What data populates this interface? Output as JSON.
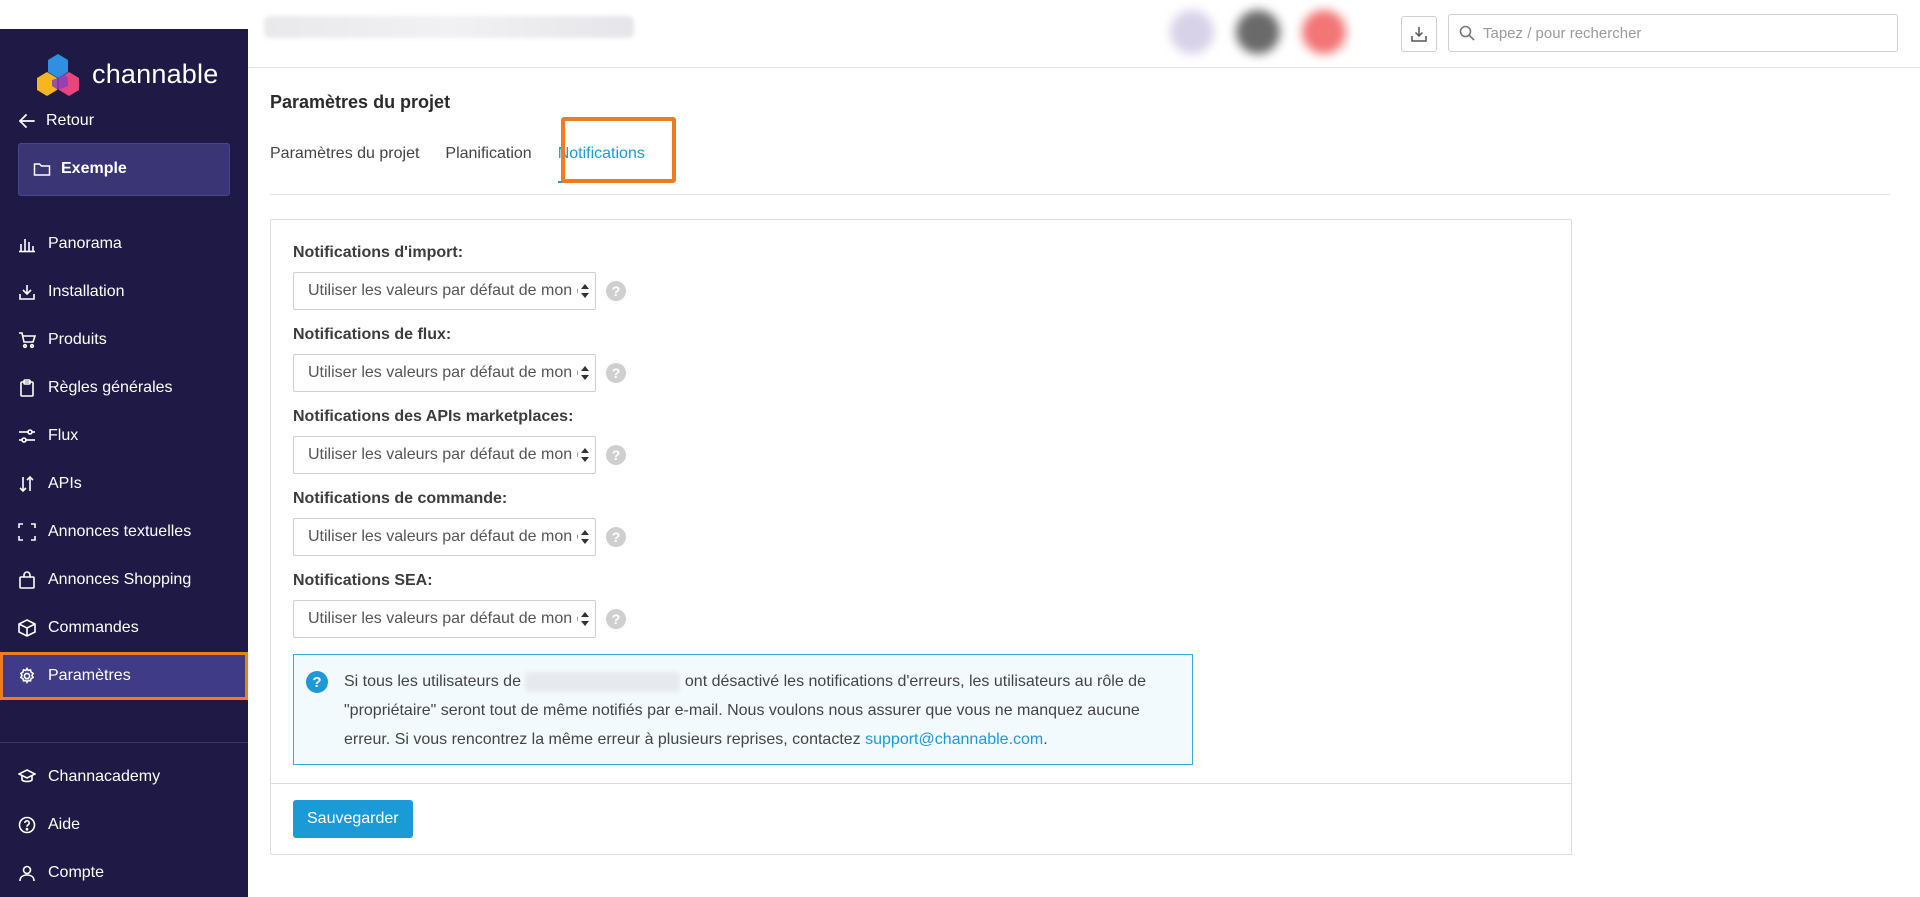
{
  "brand": {
    "name": "channable",
    "accent": "#1f98d6",
    "sidebar_bg": "#1f1a45",
    "highlight": "#f07c1f"
  },
  "sidebar": {
    "back_label": "Retour",
    "project_label": "Exemple",
    "items": [
      {
        "label": "Panorama",
        "icon": "bar-chart-icon"
      },
      {
        "label": "Installation",
        "icon": "download-tray-icon"
      },
      {
        "label": "Produits",
        "icon": "cart-icon"
      },
      {
        "label": "Règles générales",
        "icon": "clipboard-icon"
      },
      {
        "label": "Flux",
        "icon": "sliders-icon"
      },
      {
        "label": "APIs",
        "icon": "up-down-arrows-icon"
      },
      {
        "label": "Annonces textuelles",
        "icon": "frame-corners-icon"
      },
      {
        "label": "Annonces Shopping",
        "icon": "shopping-bag-icon"
      },
      {
        "label": "Commandes",
        "icon": "box-icon"
      },
      {
        "label": "Paramètres",
        "icon": "gear-icon",
        "active": true
      }
    ],
    "bottom_items": [
      {
        "label": "Channacademy",
        "icon": "graduation-cap-icon"
      },
      {
        "label": "Aide",
        "icon": "question-circle-icon"
      },
      {
        "label": "Compte",
        "icon": "user-icon"
      }
    ]
  },
  "topbar": {
    "search_placeholder": "Tapez / pour rechercher"
  },
  "page": {
    "title": "Paramètres du projet",
    "tabs": [
      {
        "label": "Paramètres du projet"
      },
      {
        "label": "Planification"
      },
      {
        "label": "Notifications",
        "active": true
      }
    ]
  },
  "form": {
    "fields": [
      {
        "label": "Notifications d'import:",
        "value": "Utiliser les valeurs par défaut de mon compte"
      },
      {
        "label": "Notifications de flux:",
        "value": "Utiliser les valeurs par défaut de mon compte"
      },
      {
        "label": "Notifications des APIs marketplaces:",
        "value": "Utiliser les valeurs par défaut de mon compte"
      },
      {
        "label": "Notifications de commande:",
        "value": "Utiliser les valeurs par défaut de mon compte"
      },
      {
        "label": "Notifications SEA:",
        "value": "Utiliser les valeurs par défaut de mon compte"
      }
    ],
    "info": {
      "text_before": "Si tous les utilisateurs de",
      "text_after": "ont désactivé les notifications d'erreurs, les utilisateurs au rôle de \"propriétaire\" seront tout de même notifiés par e-mail. Nous voulons nous assurer que vous ne manquez aucune erreur. Si vous rencontrez la même erreur à plusieurs reprises, contactez",
      "link": "support@channable.com",
      "end": "."
    },
    "save_label": "Sauvegarder"
  }
}
